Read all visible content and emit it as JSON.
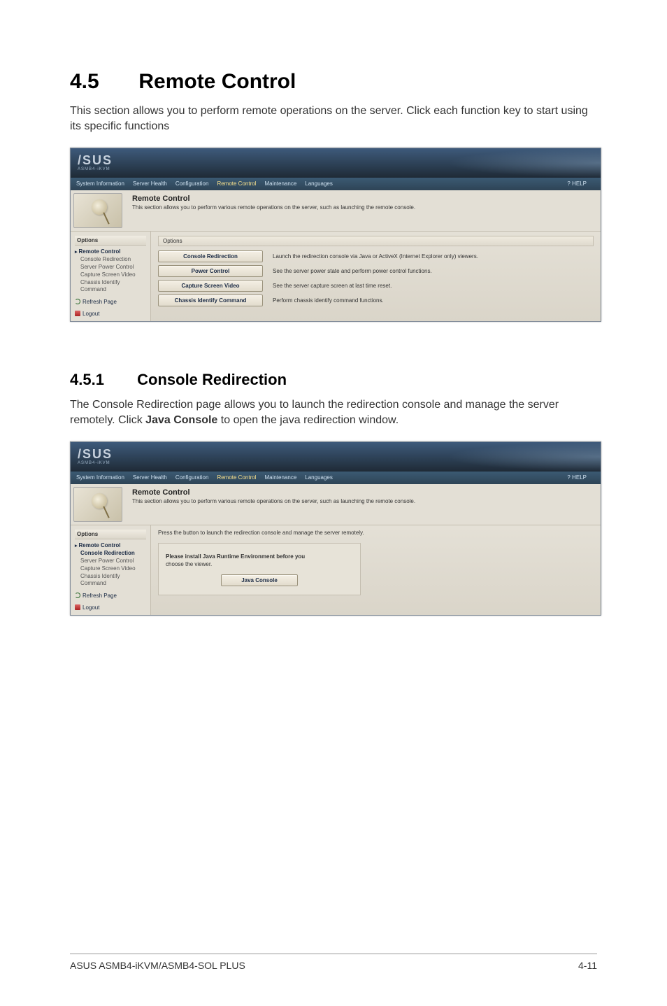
{
  "section": {
    "number": "4.5",
    "title": "Remote Control"
  },
  "section_intro": "This section allows you to perform remote operations on the server. Click each function key to start using its specific functions",
  "subsection": {
    "number": "4.5.1",
    "title": "Console Redirection"
  },
  "subsection_intro_pre": "The Console Redirection page allows you to launch the redirection console and manage the server remotely. Click ",
  "subsection_intro_bold": "Java Console",
  "subsection_intro_post": " to open the java redirection window.",
  "shot_common": {
    "logo": "/SUS",
    "logo_sub": "ASMB4-iKVM",
    "nav": [
      "System Information",
      "Server Health",
      "Configuration",
      "Remote Control",
      "Maintenance",
      "Languages"
    ],
    "nav_active_index": 3,
    "help": "HELP",
    "summary_title": "Remote Control",
    "summary_desc": "This section allows you to perform various remote operations on the server, such as launching the remote console.",
    "sidebar": {
      "options_label": "Options",
      "head": "Remote Control",
      "items": [
        "Console Redirection",
        "Server Power Control",
        "Capture Screen Video",
        "Chassis Identify Command"
      ],
      "refresh": "Refresh Page",
      "logout": "Logout"
    }
  },
  "shot1": {
    "options_label": "Options",
    "buttons": [
      {
        "label": "Console Redirection",
        "desc": "Launch the redirection console via Java or ActiveX (Internet Explorer only) viewers."
      },
      {
        "label": "Power Control",
        "desc": "See the server power state and perform power control functions."
      },
      {
        "label": "Capture Screen Video",
        "desc": "See the server capture screen at last time reset."
      },
      {
        "label": "Chassis Identify Command",
        "desc": "Perform chassis identify command functions."
      }
    ],
    "selected_sidebar_index": -1
  },
  "shot2": {
    "press_text": "Press the button to launch the redirection console and manage the server remotely.",
    "note_line1": "Please install Java Runtime Environment before you",
    "note_line2": "choose the viewer.",
    "java_button": "Java Console",
    "selected_sidebar_index": 0
  },
  "footer": {
    "left": "ASUS ASMB4-iKVM/ASMB4-SOL PLUS",
    "right": "4-11"
  }
}
